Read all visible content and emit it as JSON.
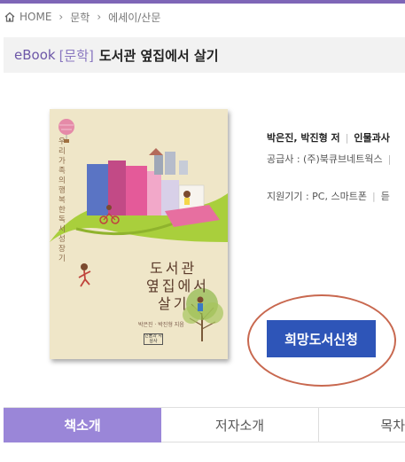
{
  "breadcrumb": {
    "home": "HOME",
    "items": [
      "문학",
      "에세이/산문"
    ]
  },
  "title": {
    "prefix": "eBook",
    "category": "[문학]",
    "name": "도서관 옆집에서 살기"
  },
  "cover": {
    "subtitle": "우리 가족의 행복한 독서 성장기",
    "title_line1": "도서관",
    "title_line2": "옆집에서",
    "title_line3": "살기",
    "authors": "박은진 · 박진형 지음",
    "publisher_logo": "인물과 사상사"
  },
  "info": {
    "authors": "박은진, 박진형 저",
    "publisher": "인물과사",
    "supplier_label": "공급사 : (주)북큐브네트웍스",
    "device_label": "지원기기 : PC, 스마트폰",
    "device_extra": "듣"
  },
  "button": {
    "wish": "희망도서신청"
  },
  "tabs": [
    "책소개",
    "저자소개",
    "목차"
  ],
  "colors": {
    "accent": "#7e66b7",
    "tab_active": "#9a86d8",
    "button": "#2e55b8",
    "circle": "#c8684f"
  }
}
